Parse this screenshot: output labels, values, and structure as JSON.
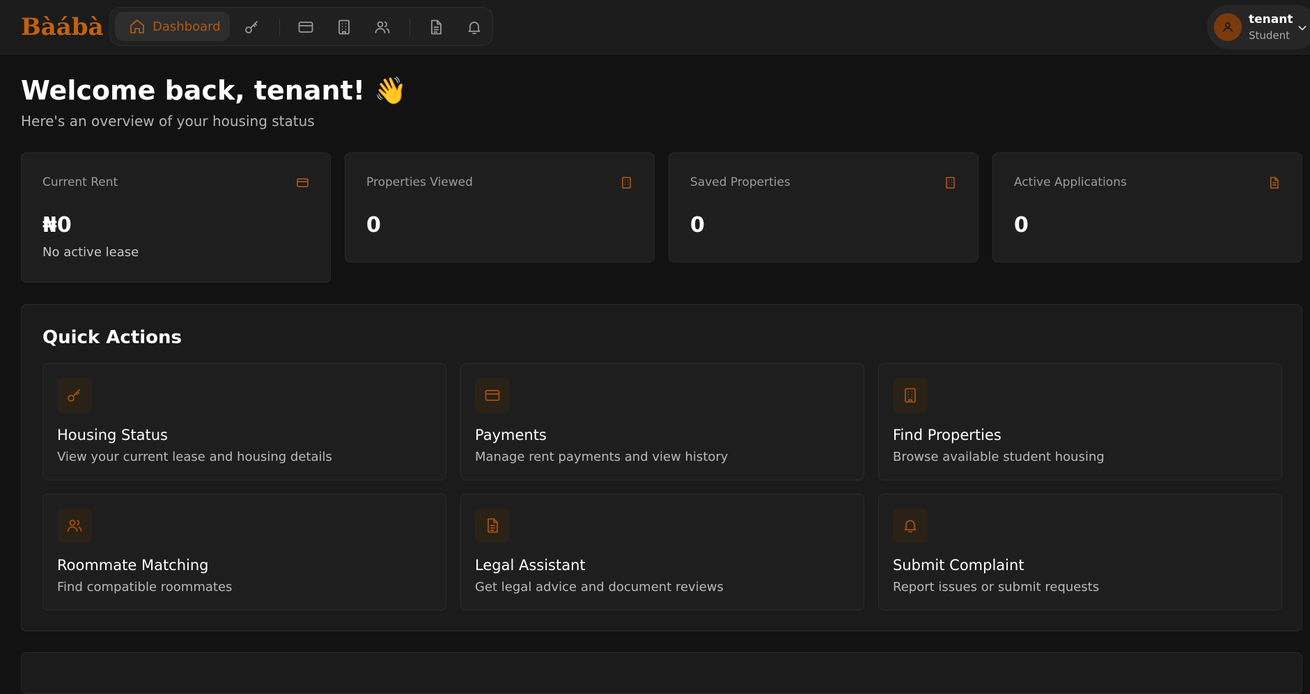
{
  "app": {
    "logo": "Bàábà"
  },
  "nav": {
    "active_label": "Dashboard",
    "items": [
      {
        "icon": "home-icon",
        "label": "Dashboard"
      },
      {
        "icon": "key-icon"
      },
      {
        "icon": "credit-card-icon"
      },
      {
        "icon": "building-icon"
      },
      {
        "icon": "users-icon"
      },
      {
        "icon": "document-icon"
      },
      {
        "icon": "bell-icon"
      }
    ]
  },
  "user": {
    "name": "tenant",
    "role": "Student",
    "avatar_icon": "user-icon"
  },
  "header": {
    "welcome": "Welcome back, tenant! 👋",
    "subtitle": "Here's an overview of your housing status"
  },
  "stats": [
    {
      "label": "Current Rent",
      "value": "₦0",
      "note": "No active lease",
      "icon": "credit-card-icon"
    },
    {
      "label": "Properties Viewed",
      "value": "0",
      "icon": "building-icon"
    },
    {
      "label": "Saved Properties",
      "value": "0",
      "icon": "building-icon"
    },
    {
      "label": "Active Applications",
      "value": "0",
      "icon": "document-icon"
    }
  ],
  "quick_actions": {
    "title": "Quick Actions",
    "items": [
      {
        "title": "Housing Status",
        "desc": "View your current lease and housing details",
        "icon": "key-icon"
      },
      {
        "title": "Payments",
        "desc": "Manage rent payments and view history",
        "icon": "credit-card-icon"
      },
      {
        "title": "Find Properties",
        "desc": "Browse available student housing",
        "icon": "building-icon"
      },
      {
        "title": "Roommate Matching",
        "desc": "Find compatible roommates",
        "icon": "users-icon"
      },
      {
        "title": "Legal Assistant",
        "desc": "Get legal advice and document reviews",
        "icon": "document-icon"
      },
      {
        "title": "Submit Complaint",
        "desc": "Report issues or submit requests",
        "icon": "bell-icon"
      }
    ]
  },
  "colors": {
    "accent": "#b05a10",
    "background": "#121212",
    "card": "#1e1e1e"
  }
}
